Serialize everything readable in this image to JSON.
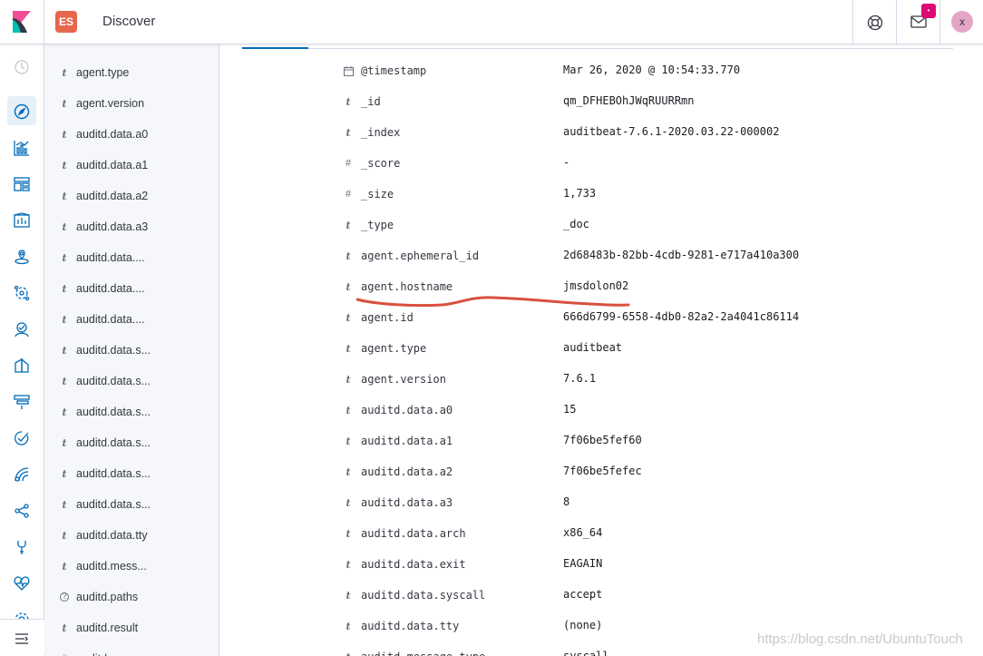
{
  "header": {
    "space_initials": "ES",
    "app_title": "Discover",
    "mail_badge": "•",
    "user_initial": "x"
  },
  "nav": {
    "icons": [
      "clock-icon",
      "compass-icon",
      "visualize-icon",
      "dashboard-icon",
      "canvas-icon",
      "maps-icon",
      "ml-icon",
      "metrics-icon",
      "logs-icon",
      "apm-icon",
      "uptime-icon",
      "siem-icon",
      "graph-icon",
      "devtools-icon",
      "monitoring-icon",
      "management-icon",
      "collapse-icon"
    ]
  },
  "fields": [
    {
      "type": "t",
      "name": "agent.type"
    },
    {
      "type": "t",
      "name": "agent.version"
    },
    {
      "type": "t",
      "name": "auditd.data.a0"
    },
    {
      "type": "t",
      "name": "auditd.data.a1"
    },
    {
      "type": "t",
      "name": "auditd.data.a2"
    },
    {
      "type": "t",
      "name": "auditd.data.a3"
    },
    {
      "type": "t",
      "name": "auditd.data...."
    },
    {
      "type": "t",
      "name": "auditd.data...."
    },
    {
      "type": "t",
      "name": "auditd.data...."
    },
    {
      "type": "t",
      "name": "auditd.data.s..."
    },
    {
      "type": "t",
      "name": "auditd.data.s..."
    },
    {
      "type": "t",
      "name": "auditd.data.s..."
    },
    {
      "type": "t",
      "name": "auditd.data.s..."
    },
    {
      "type": "t",
      "name": "auditd.data.s..."
    },
    {
      "type": "t",
      "name": "auditd.data.s..."
    },
    {
      "type": "t",
      "name": "auditd.data.tty"
    },
    {
      "type": "t",
      "name": "auditd.mess..."
    },
    {
      "type": "?",
      "name": "auditd.paths"
    },
    {
      "type": "t",
      "name": "auditd.result"
    },
    {
      "type": "#",
      "name": "auditd.seque..."
    }
  ],
  "document": [
    {
      "type": "date",
      "name": "@timestamp",
      "value": "Mar 26, 2020 @ 10:54:33.770"
    },
    {
      "type": "t",
      "name": "_id",
      "value": "qm_DFHEBOhJWqRUURRmn"
    },
    {
      "type": "t",
      "name": "_index",
      "value": "auditbeat-7.6.1-2020.03.22-000002"
    },
    {
      "type": "#",
      "name": "_score",
      "value": " -"
    },
    {
      "type": "#",
      "name": "_size",
      "value": "1,733"
    },
    {
      "type": "t",
      "name": "_type",
      "value": "_doc"
    },
    {
      "type": "t",
      "name": "agent.ephemeral_id",
      "value": "2d68483b-82bb-4cdb-9281-e717a410a300"
    },
    {
      "type": "t",
      "name": "agent.hostname",
      "value": "jmsdolon02"
    },
    {
      "type": "t",
      "name": "agent.id",
      "value": "666d6799-6558-4db0-82a2-2a4041c86114"
    },
    {
      "type": "t",
      "name": "agent.type",
      "value": "auditbeat"
    },
    {
      "type": "t",
      "name": "agent.version",
      "value": "7.6.1"
    },
    {
      "type": "t",
      "name": "auditd.data.a0",
      "value": "15"
    },
    {
      "type": "t",
      "name": "auditd.data.a1",
      "value": "7f06be5fef60"
    },
    {
      "type": "t",
      "name": "auditd.data.a2",
      "value": "7f06be5fefec"
    },
    {
      "type": "t",
      "name": "auditd.data.a3",
      "value": "8"
    },
    {
      "type": "t",
      "name": "auditd.data.arch",
      "value": "x86_64"
    },
    {
      "type": "t",
      "name": "auditd.data.exit",
      "value": "EAGAIN"
    },
    {
      "type": "t",
      "name": "auditd.data.syscall",
      "value": "accept"
    },
    {
      "type": "t",
      "name": "auditd.data.tty",
      "value": "(none)"
    },
    {
      "type": "t",
      "name": "auditd.message_type",
      "value": "syscall"
    }
  ],
  "watermark": "https://blog.csdn.net/UbuntuTouch",
  "colors": {
    "accent": "#006bb8",
    "space_badge": "#e7664c",
    "mail_badge": "#dd0a73",
    "avatar": "#e4a6c7",
    "annotation": "#d9503f"
  }
}
